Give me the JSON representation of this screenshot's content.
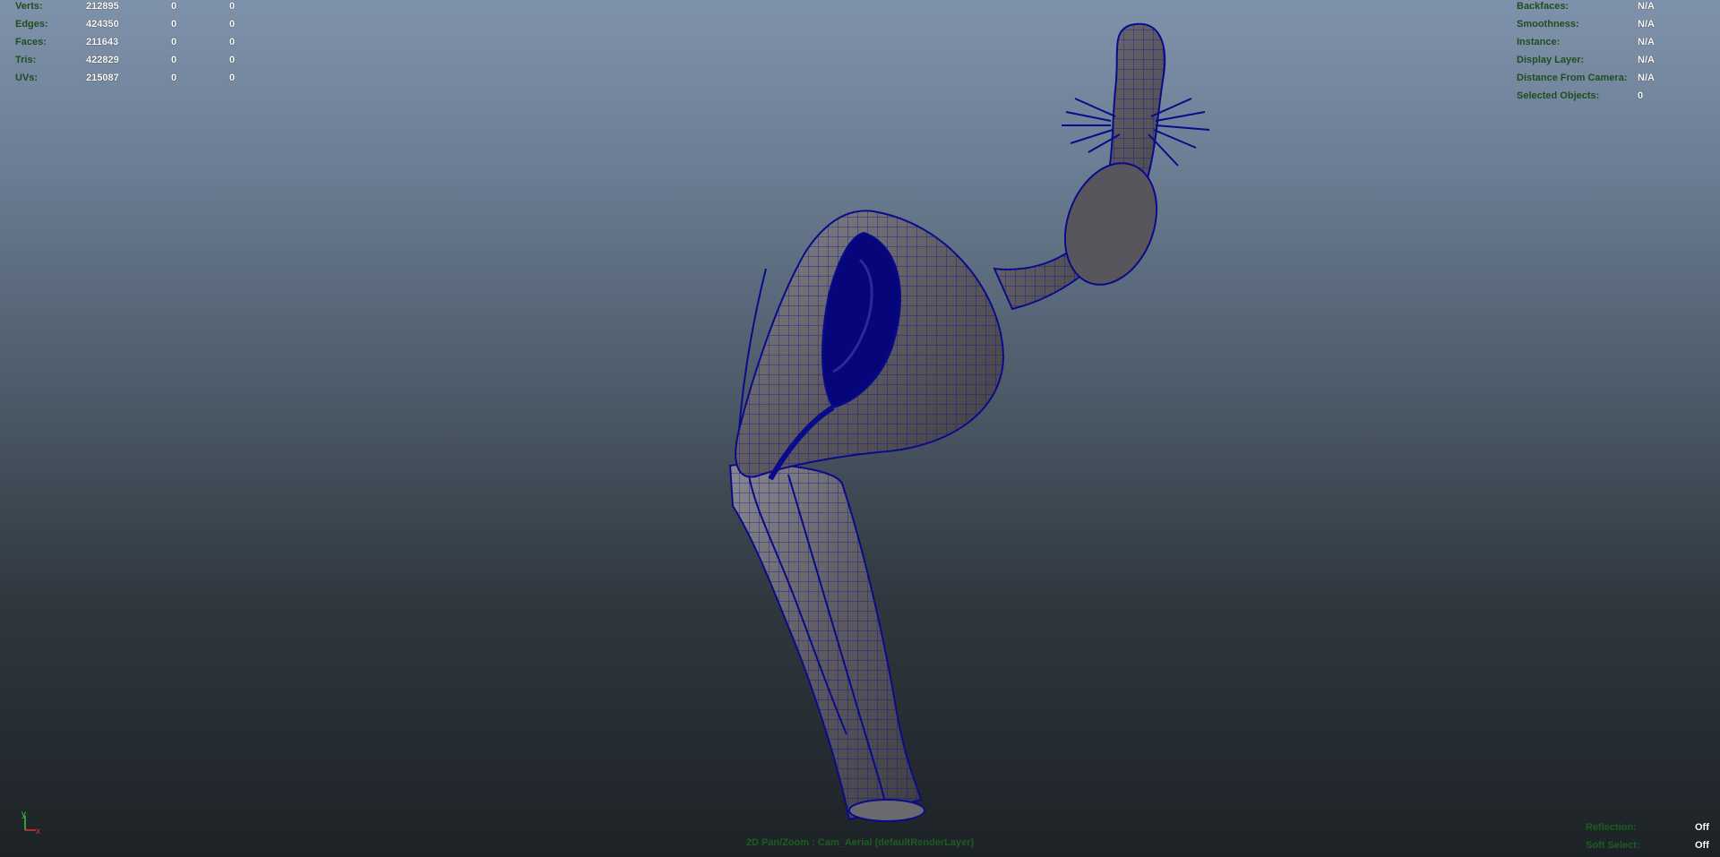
{
  "stats": {
    "rows": [
      {
        "label": "Verts:",
        "v1": "212895",
        "v2": "0",
        "v3": "0"
      },
      {
        "label": "Edges:",
        "v1": "424350",
        "v2": "0",
        "v3": "0"
      },
      {
        "label": "Faces:",
        "v1": "211643",
        "v2": "0",
        "v3": "0"
      },
      {
        "label": "Tris:",
        "v1": "422829",
        "v2": "0",
        "v3": "0"
      },
      {
        "label": "UVs:",
        "v1": "215087",
        "v2": "0",
        "v3": "0"
      }
    ]
  },
  "object_info": {
    "rows": [
      {
        "label": "Backfaces:",
        "value": "N/A"
      },
      {
        "label": "Smoothness:",
        "value": "N/A"
      },
      {
        "label": "Instance:",
        "value": "N/A"
      },
      {
        "label": "Display Layer:",
        "value": "N/A"
      },
      {
        "label": "Distance From Camera:",
        "value": "N/A"
      },
      {
        "label": "Selected Objects:",
        "value": "0"
      }
    ]
  },
  "render_flags": {
    "rows": [
      {
        "label": "Reflection:",
        "value": "Off"
      },
      {
        "label": "Soft Select:",
        "value": "Off"
      }
    ]
  },
  "camera_label": "2D Pan/Zoom : Cam_Aerial (defaultRenderLayer)",
  "axis": {
    "y": "y",
    "x": "x"
  },
  "colors": {
    "wire": "#0a0a8a",
    "surface": "#5e5c62",
    "label": "#1f4d22",
    "value": "#ffffff"
  }
}
